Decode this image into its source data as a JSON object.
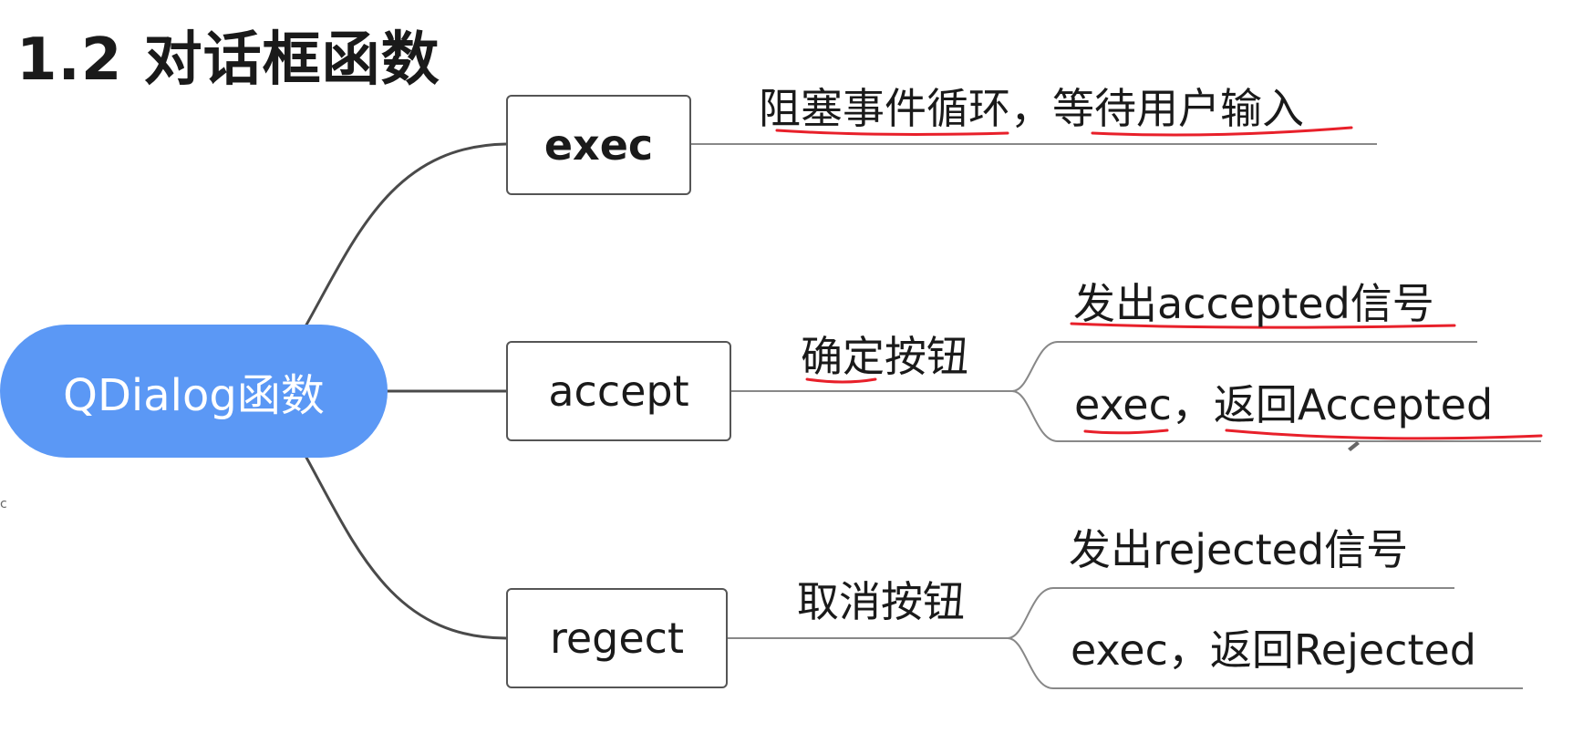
{
  "title": "1.2 对话框函数",
  "root": {
    "label": "QDialog函数",
    "color": "#5b98f5"
  },
  "branches": [
    {
      "name": "exec",
      "description": "阻塞事件循环，等待用户输入"
    },
    {
      "name": "accept",
      "button": "确定按钮",
      "outcomes": [
        "发出accepted信号",
        "exec，返回Accepted"
      ]
    },
    {
      "name": "regect",
      "button": "取消按钮",
      "outcomes": [
        "发出rejected信号",
        "exec，返回Rejected"
      ]
    }
  ],
  "stray_mark": "c",
  "colors": {
    "line": "#4a4a4a",
    "annotation": "#e8202a"
  }
}
